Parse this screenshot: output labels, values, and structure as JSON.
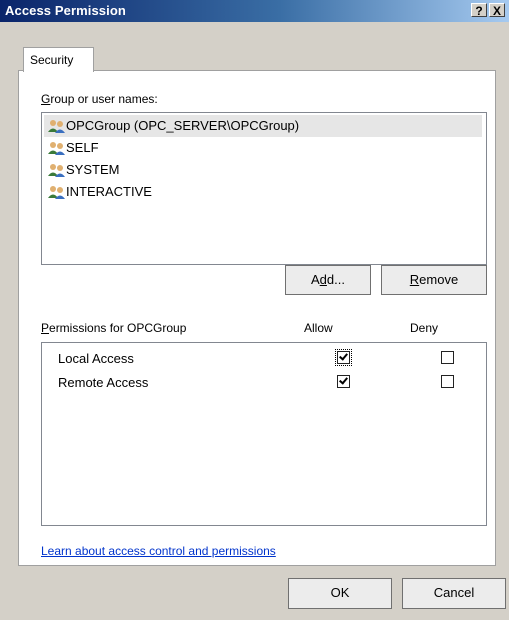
{
  "window": {
    "title": "Access Permission",
    "help_glyph": "?",
    "close_glyph": "X"
  },
  "tabs": [
    {
      "label": "Security"
    }
  ],
  "users": {
    "label_prefix": "G",
    "label_rest": "roup or user names:",
    "items": [
      {
        "name": "OPCGroup (OPC_SERVER\\OPCGroup)",
        "icon": "users-group-icon",
        "selected": true
      },
      {
        "name": "SELF",
        "icon": "users-group-icon",
        "selected": false
      },
      {
        "name": "SYSTEM",
        "icon": "users-group-icon",
        "selected": false
      },
      {
        "name": "INTERACTIVE",
        "icon": "users-group-icon",
        "selected": false
      }
    ],
    "add_pre": "A",
    "add_mnemonic": "d",
    "add_post": "d...",
    "remove_mnemonic": "R",
    "remove_post": "emove"
  },
  "permissions": {
    "label_prefix": "P",
    "label_rest": "ermissions for OPCGroup",
    "allow_header": "Allow",
    "deny_header": "Deny",
    "rows": [
      {
        "name": "Local Access",
        "allow": true,
        "deny": false
      },
      {
        "name": "Remote Access",
        "allow": true,
        "deny": false
      }
    ]
  },
  "link": "Learn about access control and permissions",
  "footer": {
    "ok": "OK",
    "cancel": "Cancel"
  },
  "colors": {
    "title_start": "#0a246a",
    "title_end": "#a6caf0",
    "link": "#0033cc"
  }
}
